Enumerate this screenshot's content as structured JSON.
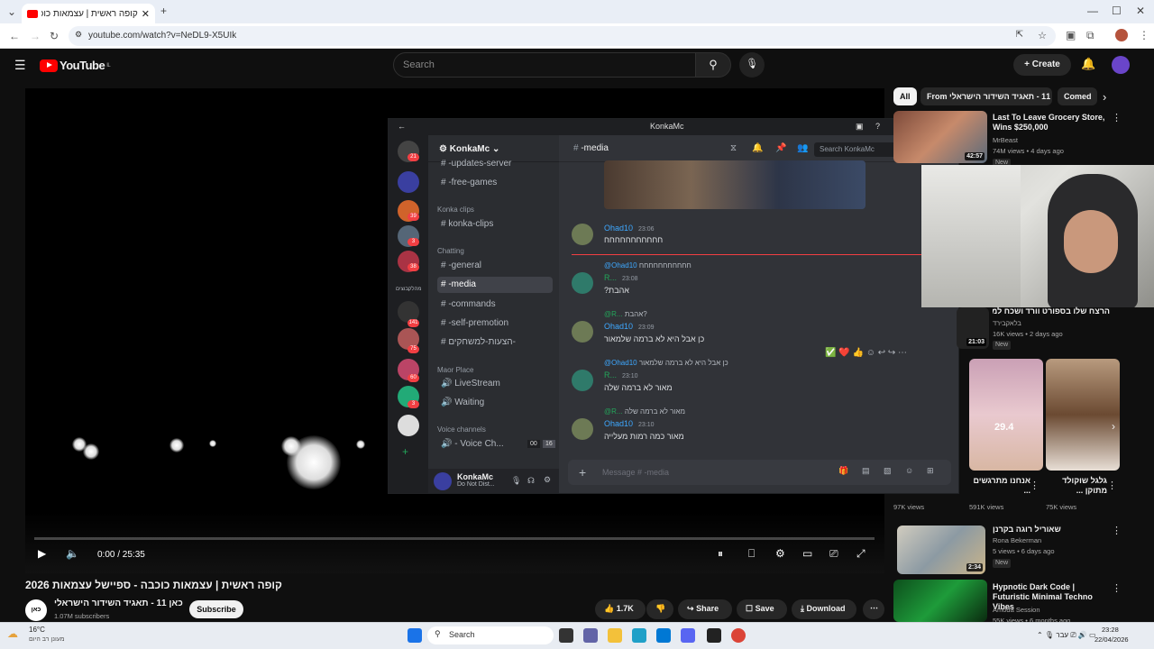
{
  "browser": {
    "tab_title": "קופה ראשית | עצמאות כוכבה",
    "url": "youtube.com/watch?v=NeDL9-X5UIk"
  },
  "youtube": {
    "logo_text": "YouTube",
    "logo_region": "IL",
    "search_placeholder": "Search",
    "create_label": "Create",
    "player": {
      "time": "0:00 / 25:35",
      "progress": 0
    },
    "video_title": "קופה ראשית | עצמאות כוכבה - ספיישל עצמאות 2026",
    "channel": {
      "avatar_text": "כאן",
      "name": "כאן 11 - תאגיד השידור הישראלי",
      "subscribers": "1.07M subscribers",
      "subscribe_label": "Subscribe"
    },
    "actions": {
      "likes": "1.7K",
      "share": "Share",
      "save": "Save",
      "download": "Download"
    },
    "chips": [
      "All",
      "From כאן 11 - תאגיד השידור הישראלי",
      "Comed"
    ],
    "recommended": [
      {
        "title": "Last To Leave Grocery Store, Wins $250,000",
        "channel": "MrBeast",
        "meta": "74M views • 4 days ago",
        "badge": "New",
        "duration": "42:57"
      },
      {
        "title": "הרצח שלו בספורט וורד ושכח למחוק...",
        "channel": "בלאקבירד",
        "meta": "16K views • 2 days ago",
        "badge": "New",
        "duration": "21:03"
      },
      {
        "title": "אנחנו מתרגשים ...",
        "meta": "591K views",
        "duration": "29.4"
      },
      {
        "title": "גלגל שוקולד מתוקן ...",
        "meta": "75K views"
      },
      {
        "title": "",
        "meta": "97K views"
      },
      {
        "title": "שאוריל רוגה בקרנן",
        "channel": "Rona Bekerman",
        "meta": "5 views • 6 days ago",
        "badge": "New",
        "duration": "2:34"
      },
      {
        "title": "Hypnotic Dark Code | Futuristic Minimal Techno Vibes",
        "channel": "Amoda Session",
        "meta": "55K views • 6 months ago"
      }
    ]
  },
  "discord": {
    "window_title": "KonkaMc",
    "server_name": "KonkaMc",
    "search_placeholder": "Search KonkaMc",
    "categories": [
      "Konka clips",
      "Chatting",
      "Maor Place",
      "Voice channels"
    ],
    "channels": [
      "-updates-server",
      "-free-games",
      "konka-clips",
      "-general",
      "-media",
      "-commands",
      "-self-premotion",
      "הצעות-למשחקים-",
      "LiveStream",
      "Waiting",
      "- Voice Ch..."
    ],
    "voice_counts": [
      "00",
      "16"
    ],
    "user": {
      "name": "KonkaMc",
      "status": "Do Not Dist..."
    },
    "current_channel": "-media",
    "message_placeholder": "Message # -media",
    "guild_badges": [
      "21",
      "39",
      "3",
      "38",
      "141",
      "75",
      "60",
      "3"
    ],
    "guild_label": "מהלקבוצים",
    "messages": [
      {
        "author": "Ohad10",
        "time": "23:06",
        "text": "חחחחחחחחחחח"
      },
      {
        "author": "R...",
        "time": "23:08",
        "reply_to": "@Ohad10",
        "reply_text": "חחחחחחחחחחח",
        "text": "אהבת?"
      },
      {
        "author": "Ohad10",
        "time": "23:09",
        "reply_to": "@R...",
        "reply_text": "אהבת?",
        "text": "כן אבל היא לא ברמה שלמאור"
      },
      {
        "author": "R...",
        "time": "23:10",
        "reply_to": "@Ohad10",
        "reply_text": "כן אבל היא לא ברמה שלמאור",
        "text": "מאור לא ברמה שלה"
      },
      {
        "author": "Ohad10",
        "time": "23:10",
        "reply_to": "@R...",
        "reply_text": "מאור לא ברמה שלה",
        "text": "מאור כמה רמות מעלייה"
      }
    ],
    "reactions": [
      "✅",
      "❤️",
      "👍"
    ]
  },
  "taskbar": {
    "weather_temp": "16°C",
    "weather_text": "מעונן רב היום",
    "search_label": "Search",
    "time": "23:28",
    "date": "22/04/2026",
    "lang": "עבר"
  }
}
